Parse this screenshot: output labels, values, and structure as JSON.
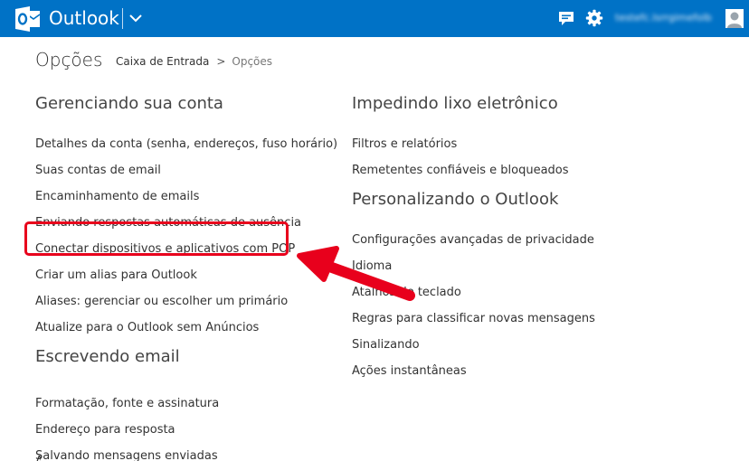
{
  "app": {
    "name": "Outlook",
    "username": "testefc.lsrrgimefolb",
    "colors": {
      "topbar": "#0072c6",
      "highlight": "#e8001c",
      "text": "#333333"
    }
  },
  "topbar": {
    "logo_icon": "outlook-logo-icon",
    "menu_icon": "chevron-down-icon",
    "chat_icon": "chat-icon",
    "settings_icon": "gear-icon",
    "avatar_icon": "person-icon"
  },
  "page": {
    "title": "Opções",
    "breadcrumb": {
      "parent": "Caixa de Entrada",
      "separator": ">",
      "current": "Opções"
    }
  },
  "sections": {
    "account": {
      "heading": "Gerenciando sua conta",
      "items": [
        "Detalhes da conta (senha, endereços, fuso horário)",
        "Suas contas de email",
        "Encaminhamento de emails",
        "Enviando respostas automáticas de ausência",
        "Conectar dispositivos e aplicativos com POP",
        "Criar um alias para Outlook",
        "Aliases: gerenciar ou escolher um primário",
        "Atualize para o Outlook sem Anúncios"
      ]
    },
    "writing": {
      "heading": "Escrevendo email",
      "items": [
        "Formatação, fonte e assinatura",
        "Endereço para resposta",
        "Salvando mensagens enviadas"
      ],
      "cut_item": "Á"
    },
    "junk": {
      "heading": "Impedindo lixo eletrônico",
      "items": [
        "Filtros e relatórios",
        "Remetentes confiáveis e bloqueados"
      ]
    },
    "personalize": {
      "heading": "Personalizando o Outlook",
      "items": [
        "Configurações avançadas de privacidade",
        "Idioma",
        "Atalhos de teclado",
        "Regras para classificar novas mensagens",
        "Sinalizando",
        "Ações instantâneas"
      ]
    }
  },
  "annotation": {
    "highlighted_item": "Conectar dispositivos e aplicativos com POP",
    "arrow_icon": "red-arrow-icon"
  }
}
